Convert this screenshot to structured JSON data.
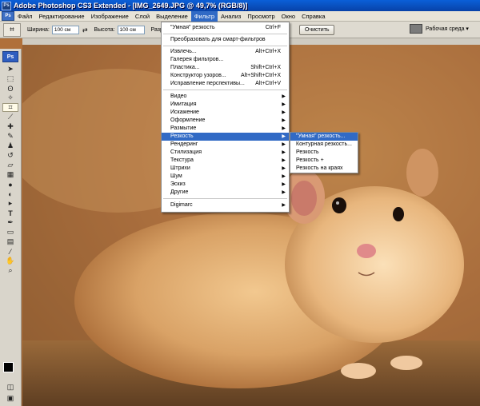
{
  "window": {
    "title": "Adobe Photoshop CS3 Extended - [IMG_2649.JPG @ 49,7% (RGB/8)]",
    "logo": "Ps"
  },
  "menubar": {
    "logo": "Ps",
    "items": [
      "Файл",
      "Редактирование",
      "Изображение",
      "Слой",
      "Выделение",
      "Фильтр",
      "Анализ",
      "Просмотр",
      "Окно",
      "Справка"
    ],
    "active": "Фильтр"
  },
  "options": {
    "width_label": "Ширина:",
    "width_value": "100 см",
    "height_label": "Высота:",
    "height_value": "100 см",
    "resolution_label": "Разреш",
    "clear_button": "Очистить",
    "workspace_label": "Рабочая среда ▾"
  },
  "toolbox": {
    "logo": "Ps"
  },
  "filter_menu": {
    "top": [
      {
        "label": "\"Умная\" резкость",
        "shortcut": "Ctrl+F"
      }
    ],
    "smart": [
      {
        "label": "Преобразовать для смарт-фильтров"
      }
    ],
    "group1": [
      {
        "label": "Извлечь...",
        "shortcut": "Alt+Ctrl+X"
      },
      {
        "label": "Галерея фильтров..."
      },
      {
        "label": "Пластика...",
        "shortcut": "Shift+Ctrl+X"
      },
      {
        "label": "Конструктор узоров...",
        "shortcut": "Alt+Shift+Ctrl+X"
      },
      {
        "label": "Исправление перспективы...",
        "shortcut": "Alt+Ctrl+V"
      }
    ],
    "group2": [
      "Видео",
      "Имитация",
      "Искажение",
      "Оформление",
      "Размытие",
      "Резкость",
      "Рендеринг",
      "Стилизация",
      "Текстура",
      "Штрихи",
      "Шум",
      "Эскиз",
      "Другие"
    ],
    "selected": "Резкость",
    "group3": [
      "Digimarc"
    ]
  },
  "sharpen_submenu": {
    "items": [
      "\"Умная\" резкость...",
      "Контурная резкость...",
      "Резкость",
      "Резкость +",
      "Резкость на краях"
    ],
    "selected": "\"Умная\" резкость..."
  },
  "icons": {
    "toolbox": [
      "move-icon",
      "marquee-icon",
      "lasso-icon",
      "magic-wand-icon",
      "crop-icon",
      "slice-icon",
      "healing-brush-icon",
      "brush-icon",
      "clone-stamp-icon",
      "history-brush-icon",
      "eraser-icon",
      "gradient-icon",
      "blur-icon",
      "dodge-icon",
      "path-selection-icon",
      "type-icon",
      "pen-icon",
      "rectangle-icon",
      "notes-icon",
      "eyedropper-icon",
      "hand-icon",
      "zoom-icon"
    ]
  }
}
